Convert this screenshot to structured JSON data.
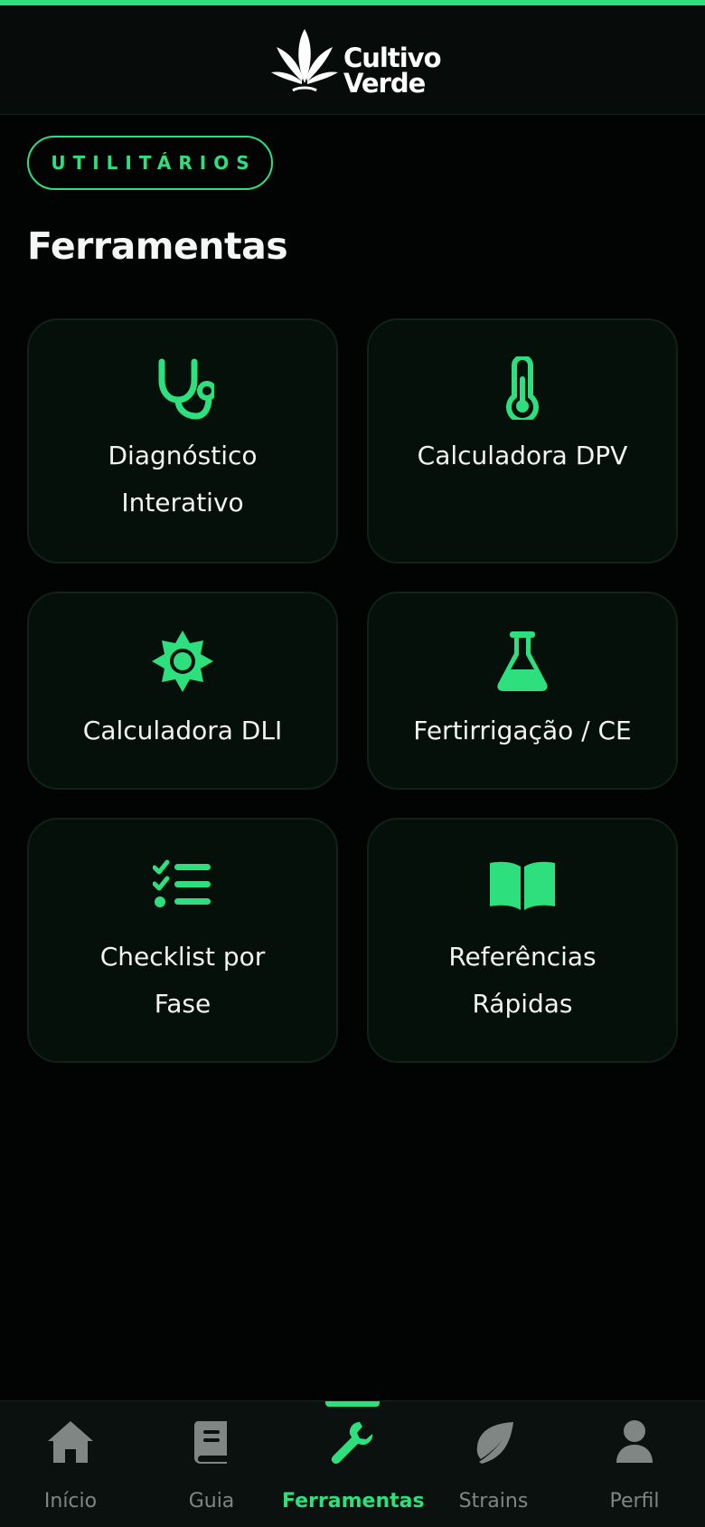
{
  "header": {
    "logo_line1": "Cultivo",
    "logo_line2": "Verde"
  },
  "section_label": "UTILITÁRIOS",
  "page_title": "Ferramentas",
  "tools": [
    {
      "line1": "Diagnóstico",
      "line2": "Interativo",
      "icon": "stethoscope-icon"
    },
    {
      "line1": "Calculadora DPV",
      "line2": "",
      "icon": "thermometer-icon"
    },
    {
      "line1": "Calculadora DLI",
      "line2": "",
      "icon": "sun-icon"
    },
    {
      "line1": "Fertirrigação / CE",
      "line2": "",
      "icon": "flask-icon"
    },
    {
      "line1": "Checklist por",
      "line2": "Fase",
      "icon": "checklist-icon"
    },
    {
      "line1": "Referências",
      "line2": "Rápidas",
      "icon": "book-open-icon"
    }
  ],
  "nav": {
    "items": [
      {
        "label": "Início",
        "icon": "home-icon"
      },
      {
        "label": "Guia",
        "icon": "book-icon"
      },
      {
        "label": "Ferramentas",
        "icon": "wrench-icon"
      },
      {
        "label": "Strains",
        "icon": "leaf-icon"
      },
      {
        "label": "Perfil",
        "icon": "user-icon"
      }
    ],
    "active": "Ferramentas"
  },
  "colors": {
    "accent": "#2ddf7d",
    "background": "#020403",
    "card": "#06100b",
    "inactive": "#7f8784"
  }
}
